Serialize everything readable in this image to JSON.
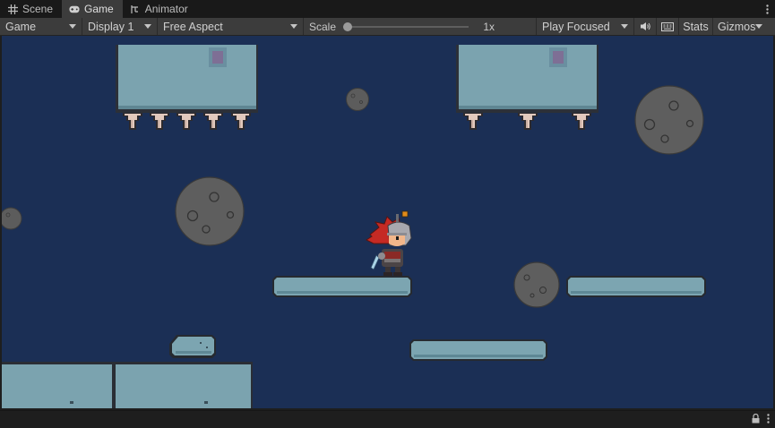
{
  "tabs": [
    {
      "label": "Scene",
      "icon": "grid-icon",
      "active": false
    },
    {
      "label": "Game",
      "icon": "gamepad-icon",
      "active": true
    },
    {
      "label": "Animator",
      "icon": "animator-icon",
      "active": false
    }
  ],
  "toolbar": {
    "view_mode": "Game",
    "display": "Display 1",
    "aspect": "Free Aspect",
    "scale_label": "Scale",
    "scale_value": "1x",
    "scale_level": 0.0,
    "play_mode": "Play Focused",
    "stats_label": "Stats",
    "gizmos_label": "Gizmos"
  },
  "colors": {
    "background": "#1b2f55",
    "platform": "#7fa7b3",
    "platform_edge": "#2b2f36",
    "moon": "#5e5e5e",
    "spike": "#e4cbbf",
    "hero_hair": "#c92a24"
  }
}
